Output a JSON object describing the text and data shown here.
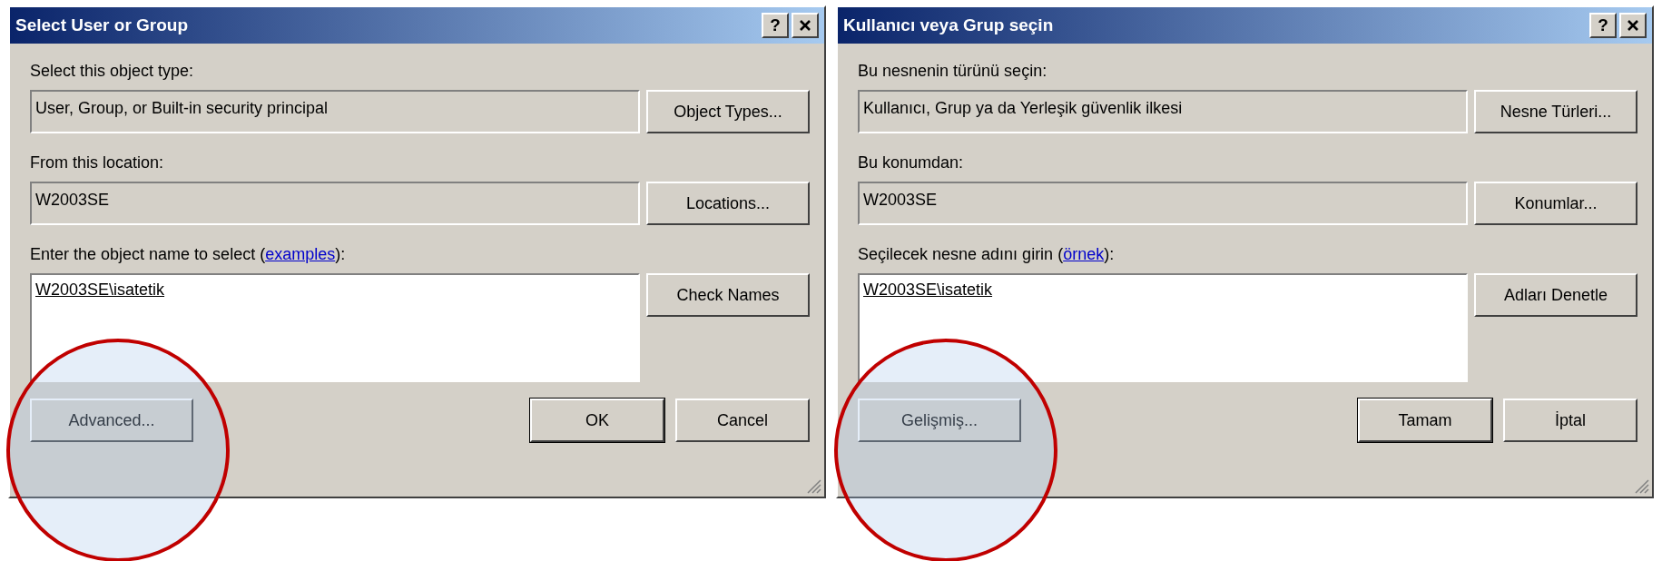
{
  "dialogs": [
    {
      "title": "Select User or Group",
      "help_button": "?",
      "type_label": "Select this object type:",
      "type_value": "User, Group, or Built-in security principal",
      "type_button": "Object Types...",
      "location_label": "From this location:",
      "location_value": "W2003SE",
      "location_button": "Locations...",
      "name_label_before": "Enter the object name to select (",
      "name_label_link": "examples",
      "name_label_after": "):",
      "name_value": "W2003SE\\isatetik",
      "check_button": "Check Names",
      "advanced_button": "Advanced...",
      "ok_button": "OK",
      "cancel_button": "Cancel"
    },
    {
      "title": "Kullanıcı veya Grup seçin",
      "help_button": "?",
      "type_label": "Bu nesnenin türünü seçin:",
      "type_value": "Kullanıcı, Grup ya da Yerleşik güvenlik ilkesi",
      "type_button": "Nesne Türleri...",
      "location_label": "Bu konumdan:",
      "location_value": "W2003SE",
      "location_button": "Konumlar...",
      "name_label_before": "Seçilecek nesne adını girin (",
      "name_label_link": "örnek",
      "name_label_after": "):",
      "name_value": "W2003SE\\isatetik",
      "check_button": "Adları Denetle",
      "advanced_button": "Gelişmiş...",
      "ok_button": "Tamam",
      "cancel_button": "İptal"
    }
  ]
}
